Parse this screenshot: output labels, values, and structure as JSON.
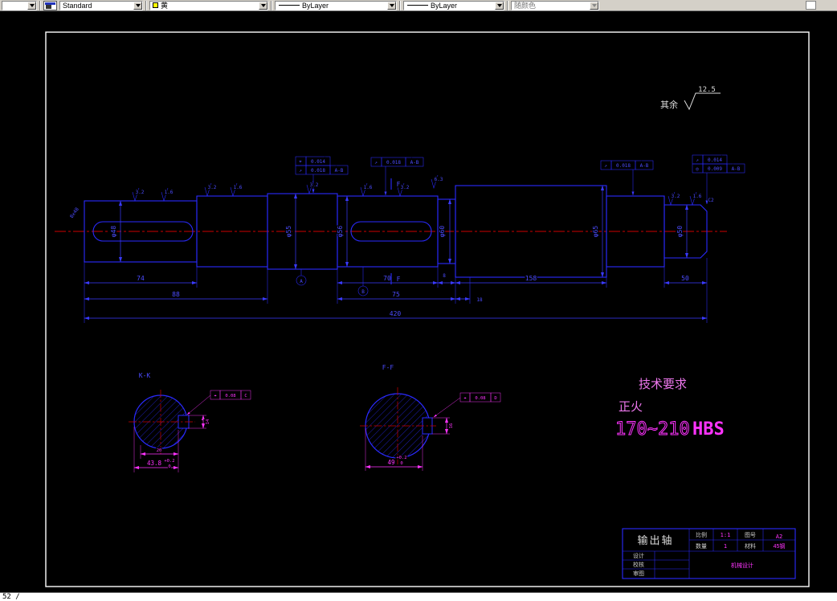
{
  "toolbar": {
    "style": "Standard",
    "color": "黄",
    "linetype": "ByLayer",
    "lineweight": "ByLayer",
    "plotstyle": "随颜色"
  },
  "commandline": {
    "text": "52 /"
  },
  "drawing": {
    "general_roughness": {
      "label": "其余",
      "value": "12.5"
    },
    "keyway_note": "8x48",
    "chamfer_note": "C2",
    "dims": {
      "d74": "74",
      "d88": "88",
      "d70": "70",
      "d8": "8",
      "d18": "18",
      "d75": "75",
      "d158": "158",
      "d50": "50",
      "d420": "420"
    },
    "dia_labels": [
      "φ48",
      "φ55",
      "φ56",
      "φ60",
      "φ65",
      "φ50"
    ],
    "roughness_values": [
      "3.2",
      "1.6",
      "3.2",
      "1.6",
      "3.2",
      "1.6",
      "3.2",
      "6.3",
      "3.2",
      "1.6"
    ],
    "datum_a": "A",
    "datum_b": "B",
    "section_letter": "F",
    "tol_frames": {
      "f1_sym": "⌖",
      "f1_val": "0.014",
      "f1b_sym": "↗",
      "f1b_val": "0.018",
      "f1b_ref": "A-B",
      "f2_sym": "↗",
      "f2_val": "0.018",
      "f2_ref": "A-B",
      "f3_sym": "↗",
      "f3_val": "0.018",
      "f3_ref": "A-B",
      "f4_sym": "↗",
      "f4_val": "0.014",
      "f4b_sym": "◎",
      "f4b_val": "0.009",
      "f4b_ref": "A-B"
    },
    "section_left": {
      "label": "K-K",
      "dim1": "20",
      "dim2": "43.8",
      "tol_up": "+0.2",
      "tol_dn": "0",
      "side_dim": "14",
      "tol_sym": "⌖",
      "tol_val": "0.08",
      "tol_ref": "C"
    },
    "section_right": {
      "label": "F-F",
      "dim": "49",
      "tol_up": "+0.2",
      "tol_dn": "0",
      "side_dim": "16",
      "tol_sym": "⌖",
      "tol_val": "0.08",
      "tol_ref": "D"
    },
    "tech": {
      "title": "技术要求",
      "treatment": "正火",
      "hardness": "170~210",
      "unit": "HBS"
    }
  },
  "titleblock": {
    "part_name": "输出轴",
    "scale_label": "比例",
    "scale": "1:1",
    "sheet_label": "图号",
    "sheet": "A2",
    "qty_label": "数量",
    "qty": "1",
    "material_label": "材料",
    "material": "45钢",
    "row1": "设计",
    "row2": "校核",
    "row3": "审图",
    "course": "机械设计"
  }
}
